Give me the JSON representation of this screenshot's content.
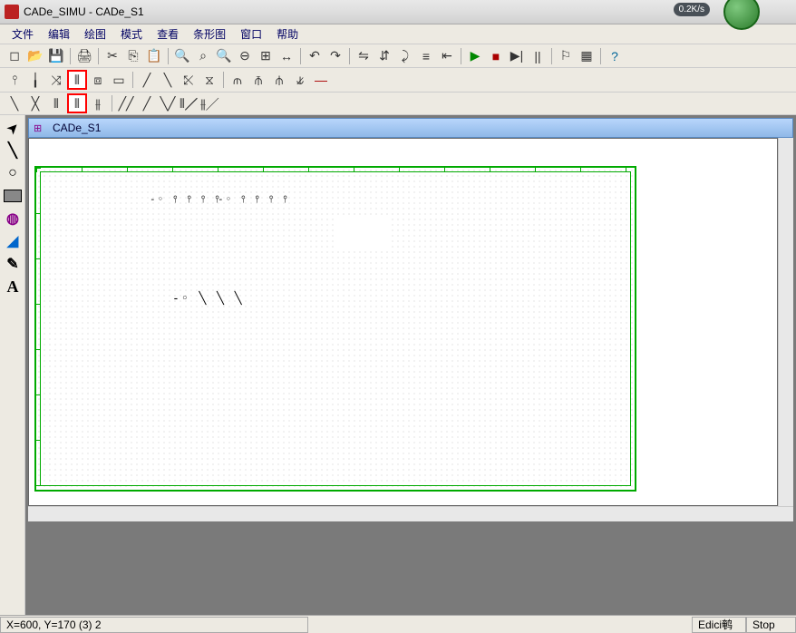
{
  "window": {
    "title": "CADe_SIMU - CADe_S1",
    "speed_indicator": "0.2K/s"
  },
  "menu": {
    "items": [
      "文件",
      "编辑",
      "绘图",
      "模式",
      "查看",
      "条形图",
      "窗口",
      "帮助"
    ]
  },
  "toolbar1": {
    "items": [
      {
        "name": "new-icon",
        "glyph": "◻"
      },
      {
        "name": "open-icon",
        "glyph": "📂"
      },
      {
        "name": "save-icon",
        "glyph": "💾"
      },
      {
        "name": "sep"
      },
      {
        "name": "print-icon",
        "glyph": "🖨"
      },
      {
        "name": "sep"
      },
      {
        "name": "cut-icon",
        "glyph": "✂"
      },
      {
        "name": "copy-icon",
        "glyph": "⎘"
      },
      {
        "name": "paste-icon",
        "glyph": "📋"
      },
      {
        "name": "sep"
      },
      {
        "name": "find-icon",
        "glyph": "🔍"
      },
      {
        "name": "zoom-fit-icon",
        "glyph": "⌕"
      },
      {
        "name": "zoom-icon",
        "glyph": "🔍"
      },
      {
        "name": "zoom-out-icon",
        "glyph": "⊖"
      },
      {
        "name": "zoom-window-icon",
        "glyph": "⊞"
      },
      {
        "name": "pan-icon",
        "glyph": "↔"
      },
      {
        "name": "sep"
      },
      {
        "name": "rotate-left-icon",
        "glyph": "↶"
      },
      {
        "name": "rotate-right-icon",
        "glyph": "↷"
      },
      {
        "name": "sep"
      },
      {
        "name": "mirror-h-icon",
        "glyph": "⇋"
      },
      {
        "name": "mirror-v-icon",
        "glyph": "⇵"
      },
      {
        "name": "flip-icon",
        "glyph": "⤸"
      },
      {
        "name": "align-icon",
        "glyph": "≡"
      },
      {
        "name": "nudge-icon",
        "glyph": "⇤"
      },
      {
        "name": "sep"
      },
      {
        "name": "play-icon",
        "glyph": "▶",
        "color": "#080"
      },
      {
        "name": "stop-icon",
        "glyph": "■",
        "color": "#a00"
      },
      {
        "name": "step-icon",
        "glyph": "▶|"
      },
      {
        "name": "pause-icon",
        "glyph": "||"
      },
      {
        "name": "sep"
      },
      {
        "name": "flag-icon",
        "glyph": "⚐"
      },
      {
        "name": "grid-icon",
        "glyph": "▦"
      },
      {
        "name": "sep"
      },
      {
        "name": "help-icon",
        "glyph": "?",
        "color": "#069"
      }
    ]
  },
  "toolbar2": {
    "items": [
      {
        "name": "fuse-icon",
        "glyph": "⫯"
      },
      {
        "name": "connector-icon",
        "glyph": "╽"
      },
      {
        "name": "switch-nc-icon",
        "glyph": "⤨"
      },
      {
        "name": "contact-3p-icon",
        "glyph": "⫴",
        "highlighted": true
      },
      {
        "name": "breaker-icon",
        "glyph": "⧈"
      },
      {
        "name": "relay-icon",
        "glyph": "▭"
      },
      {
        "name": "sep"
      },
      {
        "name": "no-contact-icon",
        "glyph": "╱"
      },
      {
        "name": "nc-contact-icon",
        "glyph": "╲"
      },
      {
        "name": "changeover-icon",
        "glyph": "⤪"
      },
      {
        "name": "delayed-icon",
        "glyph": "⧖"
      },
      {
        "name": "sep"
      },
      {
        "name": "thermal-icon",
        "glyph": "⫙"
      },
      {
        "name": "motor-protect-icon",
        "glyph": "⫚"
      },
      {
        "name": "overcurrent-icon",
        "glyph": "⫛"
      },
      {
        "name": "overload-icon",
        "glyph": "⫝̸"
      },
      {
        "name": "line-icon",
        "glyph": "—",
        "color": "#a00"
      }
    ]
  },
  "toolbar3": {
    "items": [
      {
        "name": "wire-icon",
        "glyph": "╲"
      },
      {
        "name": "contact2-icon",
        "glyph": "╳"
      },
      {
        "name": "contact3-icon",
        "glyph": "⫴"
      },
      {
        "name": "contact3-hl-icon",
        "glyph": "⫴",
        "highlighted": true
      },
      {
        "name": "contact4-icon",
        "glyph": "⫵"
      },
      {
        "name": "sep"
      },
      {
        "name": "aux1-icon",
        "glyph": "╱╱"
      },
      {
        "name": "aux2-icon",
        "glyph": "╱"
      },
      {
        "name": "aux3-icon",
        "glyph": "╲╱"
      },
      {
        "name": "aux4-icon",
        "glyph": "⫴╱"
      },
      {
        "name": "aux5-icon",
        "glyph": "⫵╱"
      }
    ]
  },
  "left_tools": [
    {
      "name": "pointer-icon",
      "glyph": "➤"
    },
    {
      "name": "line-tool-icon",
      "glyph": "╲"
    },
    {
      "name": "ellipse-icon",
      "glyph": "○"
    },
    {
      "name": "rectangle-icon",
      "glyph": "▭"
    },
    {
      "name": "fill-ellipse-icon",
      "glyph": "◍"
    },
    {
      "name": "fill-icon",
      "glyph": "◢"
    },
    {
      "name": "eyedropper-icon",
      "glyph": "✎"
    },
    {
      "name": "text-icon",
      "glyph": "A"
    }
  ],
  "document": {
    "title": "CADe_S1"
  },
  "canvas_components": {
    "group1": "-◦ ⫯ ⫯ ⫯ ⫯",
    "group2": "-◦ ⫯ ⫯ ⫯ ⫯",
    "group3": "-◦ ╲ ╲ ╲"
  },
  "statusbar": {
    "coords": "X=600, Y=170 (3) 2",
    "mode": "Edici鹌",
    "state": "Stop"
  }
}
